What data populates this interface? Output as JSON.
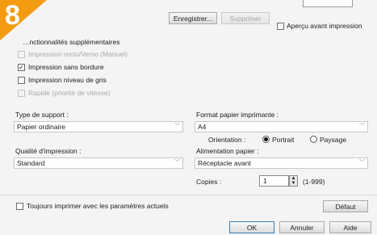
{
  "badge": {
    "number": "8"
  },
  "toolbar": {
    "enregistrer_label": "Enregistrer...",
    "supprimer_label": "Supprimer",
    "apercu_label": "Aperçu avant impression"
  },
  "features": {
    "title": "…nctionnalités supplémentaires",
    "items": [
      {
        "label": "Impression recto/Verso (Manuel)",
        "checked": false,
        "enabled": false
      },
      {
        "label": "Impression sans bordure",
        "checked": true,
        "enabled": true
      },
      {
        "label": "Impression niveau de gris",
        "checked": false,
        "enabled": true
      },
      {
        "label": "Rapide (priorité de vitesse)",
        "checked": false,
        "enabled": false
      }
    ]
  },
  "left": {
    "type_support_label": "Type de support :",
    "type_support_value": "Papier ordinaire",
    "qualite_label": "Qualité d'impression :",
    "qualite_value": "Standard"
  },
  "right": {
    "format_label": "Format papier imprimante :",
    "format_value": "A4",
    "orientation_label": "Orientation :",
    "portrait_label": "Portrait",
    "paysage_label": "Paysage",
    "alimentation_label": "Alimentation papier :",
    "alimentation_value": "Réceptacle avant",
    "copies_label": "Copies :",
    "copies_value": "1",
    "copies_range": "(1-999)"
  },
  "footer": {
    "toujours_label": "Toujours imprimer avec les paramètres actuels",
    "defaut_label": "Défaut",
    "ok_label": "OK",
    "annuler_label": "Annuler",
    "aide_label": "Aide"
  }
}
